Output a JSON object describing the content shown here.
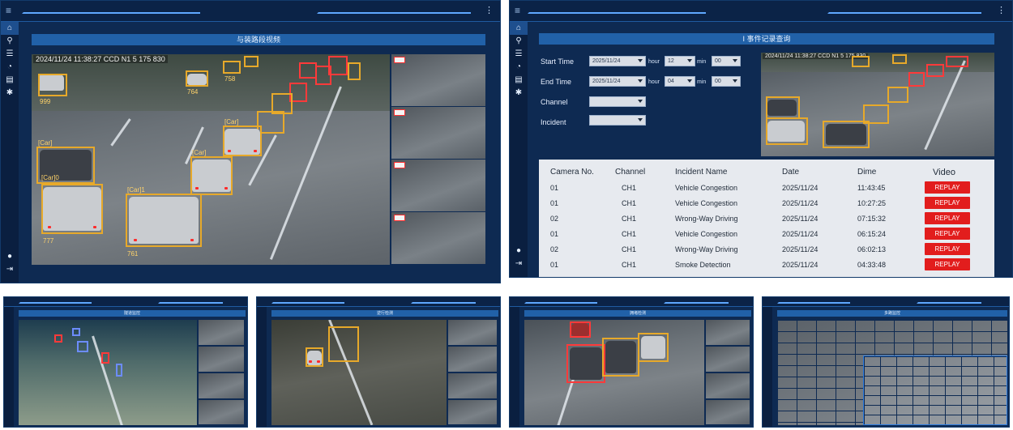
{
  "panel1": {
    "title": "与装路段视频",
    "osd_time": "2024/11/24   11:38:27 CCD N1 5 175 830",
    "labels": [
      "999",
      "764",
      "758",
      "[Car]",
      "[Car]0",
      "777",
      "[Car]1",
      "761",
      "[Car]",
      "[Car]"
    ]
  },
  "panel2": {
    "title": "I 事件记录查询",
    "form": {
      "start_time_label": "Start Time",
      "start_date": "2025/11/24",
      "start_hour": "12",
      "start_min": "00",
      "end_time_label": "End Time",
      "end_date": "2025/11/24",
      "end_hour": "04",
      "end_min": "00",
      "hour_unit": "hour",
      "min_unit": "min",
      "channel_label": "Channel",
      "channel_value": "",
      "incident_label": "Incident",
      "incident_value": ""
    },
    "preview_osd": "2024/11/24  11:38:27 CCD N1 5 175 830",
    "table": {
      "headers": {
        "camera": "Camera No.",
        "channel": "Channel",
        "incident": "Incident Name",
        "date": "Date",
        "time": "Dime",
        "video": "Video"
      },
      "rows": [
        {
          "camera": "01",
          "channel": "CH1",
          "incident": "Vehicle Congestion",
          "date": "2025/11/24",
          "time": "11:43:45",
          "action": "REPLAY"
        },
        {
          "camera": "01",
          "channel": "CH1",
          "incident": "Vehicle Congestion",
          "date": "2025/11/24",
          "time": "10:27:25",
          "action": "REPLAY"
        },
        {
          "camera": "02",
          "channel": "CH1",
          "incident": "Wrong-Way Driving",
          "date": "2025/11/24",
          "time": "07:15:32",
          "action": "REPLAY"
        },
        {
          "camera": "01",
          "channel": "CH1",
          "incident": "Vehicle Congestion",
          "date": "2025/11/24",
          "time": "06:15:24",
          "action": "REPLAY"
        },
        {
          "camera": "02",
          "channel": "CH1",
          "incident": "Wrong-Way Driving",
          "date": "2025/11/24",
          "time": "06:02:13",
          "action": "REPLAY"
        },
        {
          "camera": "01",
          "channel": "CH1",
          "incident": "Smoke Detection",
          "date": "2025/11/24",
          "time": "04:33:48",
          "action": "REPLAY"
        }
      ]
    }
  },
  "mini_panels": [
    {
      "title": "隧道监控"
    },
    {
      "title": "逆行检测"
    },
    {
      "title": "拥堵检测"
    },
    {
      "title": "多路监控"
    }
  ],
  "icons": {
    "menu": "menu-icon",
    "home": "home-icon",
    "search": "search-icon",
    "settings": "settings-icon",
    "user": "user-icon",
    "logout": "logout-icon"
  },
  "colors": {
    "panel_bg": "#0e2a52",
    "title_bar": "#2161a8",
    "bbox": "#e7a92a",
    "alert": "#ff3a3a",
    "replay": "#e21d1d"
  }
}
